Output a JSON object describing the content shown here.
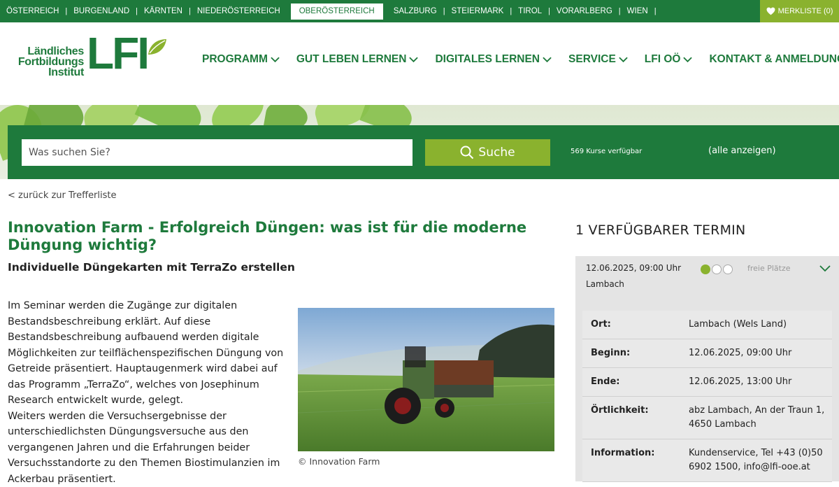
{
  "topbar": {
    "regions": [
      "ÖSTERREICH",
      "BURGENLAND",
      "KÄRNTEN",
      "NIEDERÖSTERREICH",
      "OBERÖSTERREICH",
      "SALZBURG",
      "STEIERMARK",
      "TIROL",
      "VORARLBERG",
      "WIEN"
    ],
    "active_region": "OBERÖSTERREICH",
    "merkliste": "MERKLISTE (0)"
  },
  "logo": {
    "line1": "Ländliches",
    "line2": "Fortbildungs",
    "line3": "Institut",
    "mark": "LFI"
  },
  "nav": [
    {
      "label": "PROGRAMM",
      "dropdown": true
    },
    {
      "label": "GUT LEBEN LERNEN",
      "dropdown": true
    },
    {
      "label": "DIGITALES LERNEN",
      "dropdown": true
    },
    {
      "label": "SERVICE",
      "dropdown": true
    },
    {
      "label": "LFI OÖ",
      "dropdown": true
    },
    {
      "label": "KONTAKT & ANMELDUNG",
      "dropdown": false
    }
  ],
  "search": {
    "placeholder": "Was suchen Sie?",
    "button": "Suche",
    "count": "569 Kurse verfügbar",
    "show_all": "(alle anzeigen)"
  },
  "back_link": "< zurück zur Trefferliste",
  "course": {
    "title": "Innovation Farm - Erfolgreich Düngen: was ist für die moderne Düngung wichtig?",
    "subtitle": "Individuelle Düngekarten mit TerraZo erstellen",
    "description": "Im Seminar werden die Zugänge zur digitalen Bestandsbeschreibung erklärt. Auf diese Bestandsbeschreibung aufbauend werden digitale Möglichkeiten zur teilflächenspezifischen Düngung von Getreide präsentiert. Hauptaugenmerk wird dabei auf das Programm „TerraZo“, welches von Josephinum Research entwickelt wurde, gelegt.",
    "description2": "Weiters werden die Versuchsergebnisse der unterschiedlichsten Düngungsversuche aus den vergangenen Jahren und die Erfahrungen beider Versuchsstandorte zu den Themen Biostimulanzien im Ackerbau präsentiert.",
    "image_caption": "©  Innovation Farm"
  },
  "termine": {
    "heading": "1 VERFÜGBARER TERMIN",
    "date": "12.06.2025, 09:00 Uhr",
    "location": "Lambach",
    "availability": "freie Plätze",
    "availability_level": 1,
    "details": [
      {
        "k": "Ort:",
        "v": "Lambach (Wels Land)"
      },
      {
        "k": "Beginn:",
        "v": "12.06.2025, 09:00 Uhr"
      },
      {
        "k": "Ende:",
        "v": "12.06.2025, 13:00 Uhr"
      },
      {
        "k": "Örtlichkeit:",
        "v": "abz Lambach, An der Traun 1, 4650 Lambach"
      },
      {
        "k": "Information:",
        "v": "Kundenservice, Tel +43 (0)50 6902 1500, info@lfi-ooe.at"
      }
    ]
  },
  "colors": {
    "primary": "#1e7a3c",
    "accent": "#8ab22e"
  }
}
